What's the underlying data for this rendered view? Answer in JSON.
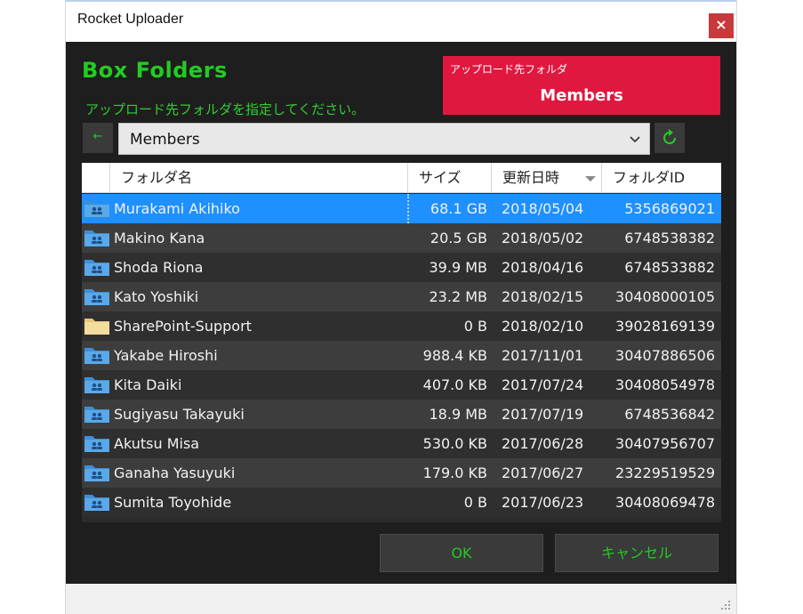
{
  "window": {
    "title": "Rocket Uploader",
    "close_glyph": "×"
  },
  "header": {
    "heading": "Box Folders",
    "instruction": "アップロード先フォルダを指定してください。",
    "destination_label": "アップロード先フォルダ",
    "destination_value": "Members"
  },
  "toolbar": {
    "back_icon": "back-arrow-icon",
    "back_glyph": "←",
    "combo_value": "Members",
    "refresh_icon": "refresh-icon"
  },
  "table": {
    "columns": [
      "フォルダ名",
      "サイズ",
      "更新日時",
      "フォルダID"
    ],
    "sorted_column": "更新日時",
    "rows": [
      {
        "name": "Murakami Akihiko",
        "size": "68.1 GB",
        "date": "2018/05/04",
        "id": "5356869021",
        "icon": "shared-folder-icon",
        "selected": true
      },
      {
        "name": "Makino Kana",
        "size": "20.5 GB",
        "date": "2018/05/02",
        "id": "6748538382",
        "icon": "shared-folder-icon"
      },
      {
        "name": "Shoda Riona",
        "size": "39.9 MB",
        "date": "2018/04/16",
        "id": "6748533882",
        "icon": "shared-folder-icon"
      },
      {
        "name": "Kato Yoshiki",
        "size": "23.2 MB",
        "date": "2018/02/15",
        "id": "30408000105",
        "icon": "shared-folder-icon"
      },
      {
        "name": "SharePoint-Support",
        "size": "0 B",
        "date": "2018/02/10",
        "id": "39028169139",
        "icon": "folder-icon"
      },
      {
        "name": "Yakabe Hiroshi",
        "size": "988.4 KB",
        "date": "2017/11/01",
        "id": "30407886506",
        "icon": "shared-folder-icon"
      },
      {
        "name": "Kita Daiki",
        "size": "407.0 KB",
        "date": "2017/07/24",
        "id": "30408054978",
        "icon": "shared-folder-icon"
      },
      {
        "name": "Sugiyasu Takayuki",
        "size": "18.9 MB",
        "date": "2017/07/19",
        "id": "6748536842",
        "icon": "shared-folder-icon"
      },
      {
        "name": "Akutsu Misa",
        "size": "530.0 KB",
        "date": "2017/06/28",
        "id": "30407956707",
        "icon": "shared-folder-icon"
      },
      {
        "name": "Ganaha Yasuyuki",
        "size": "179.0 KB",
        "date": "2017/06/27",
        "id": "23229519529",
        "icon": "shared-folder-icon"
      },
      {
        "name": "Sumita Toyohide",
        "size": "0 B",
        "date": "2017/06/23",
        "id": "30408069478",
        "icon": "shared-folder-icon"
      }
    ]
  },
  "footer": {
    "ok_label": "OK",
    "cancel_label": "キャンセル"
  },
  "colors": {
    "accent_green": "#22cc22",
    "destination_red": "#e0183f",
    "selection_blue": "#1e90ff",
    "background": "#1e1e1e"
  }
}
